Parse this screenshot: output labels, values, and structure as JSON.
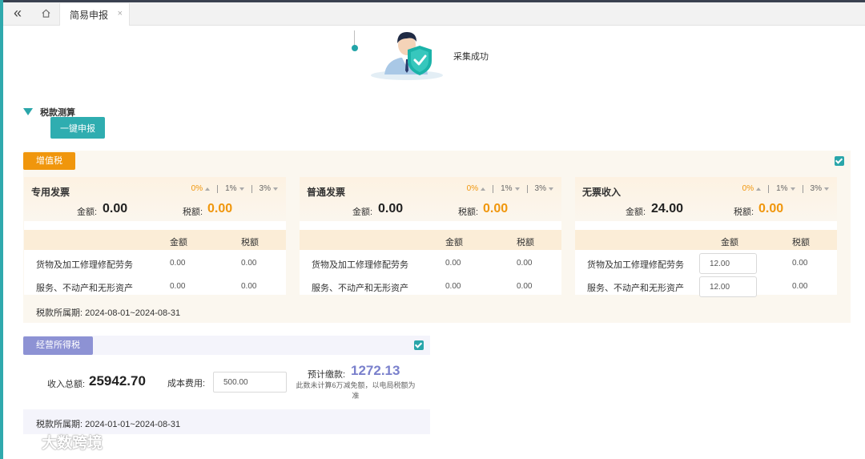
{
  "tabs": {
    "active_label": "简易申报",
    "close_glyph": "×",
    "back_glyph": "«",
    "home_glyph": "⌂"
  },
  "status": {
    "text": "采集成功"
  },
  "section": {
    "title": "税款测算",
    "declare_button": "一键申报"
  },
  "vat": {
    "tag": "增值税",
    "checked": true,
    "amount_label": "金额:",
    "tax_label": "税额:",
    "col_amount": "金额",
    "col_tax": "税额",
    "rates": [
      "0%",
      "1%",
      "3%"
    ],
    "active_rate": "0%",
    "cards": [
      {
        "title": "专用发票",
        "amount": "0.00",
        "tax": "0.00",
        "rows": [
          {
            "label": "货物及加工修理修配劳务",
            "amount": "0.00",
            "tax": "0.00"
          },
          {
            "label": "服务、不动产和无形资产",
            "amount": "0.00",
            "tax": "0.00"
          }
        ]
      },
      {
        "title": "普通发票",
        "amount": "0.00",
        "tax": "0.00",
        "rows": [
          {
            "label": "货物及加工修理修配劳务",
            "amount": "0.00",
            "tax": "0.00"
          },
          {
            "label": "服务、不动产和无形资产",
            "amount": "0.00",
            "tax": "0.00"
          }
        ]
      },
      {
        "title": "无票收入",
        "amount": "24.00",
        "tax": "0.00",
        "rows": [
          {
            "label": "货物及加工修理修配劳务",
            "amount": "12.00",
            "tax": "0.00"
          },
          {
            "label": "服务、不动产和无形资产",
            "amount": "12.00",
            "tax": "0.00"
          }
        ]
      }
    ],
    "period": "税款所属期:  2024-08-01~2024-08-31"
  },
  "income_tax": {
    "tag": "经营所得税",
    "checked": true,
    "total_income_label": "收入总额:",
    "total_income": "25942.70",
    "cost_label": "成本费用:",
    "cost_value": "500.00",
    "estimate_label": "预计缴款:",
    "estimate_value": "1272.13",
    "note": "此数未计算6万减免额，以电局税额为准",
    "period": "税款所属期:  2024-01-01~2024-08-31"
  },
  "watermark": {
    "text": "大数跨境"
  },
  "colors": {
    "teal": "#2aa6aa",
    "orange": "#f0960c",
    "purple": "#8d92d4"
  }
}
